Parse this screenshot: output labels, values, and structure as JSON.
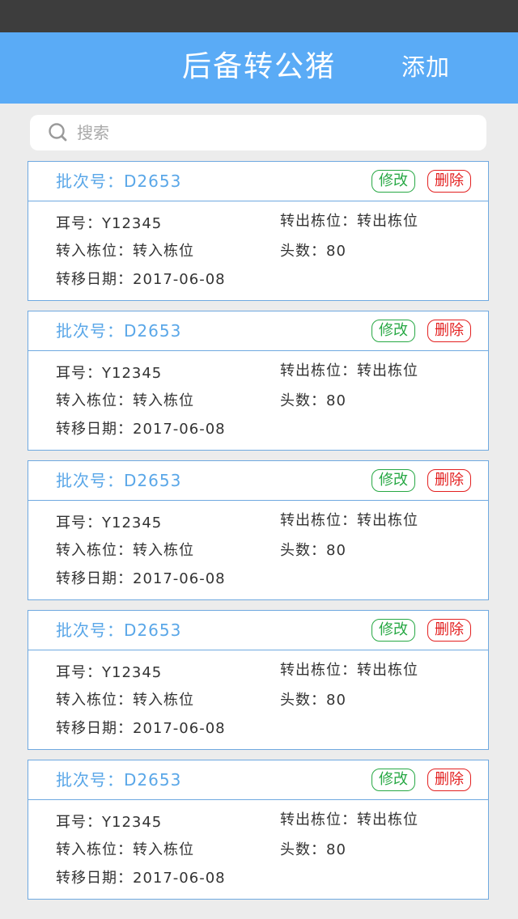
{
  "header": {
    "title": "后备转公猪",
    "add_label": "添加"
  },
  "search": {
    "placeholder": "搜索",
    "value": ""
  },
  "labels": {
    "ear": "耳号",
    "out_pen": "转出栋位",
    "in_pen": "转入栋位",
    "head_count": "头数",
    "date": "转移日期",
    "batch": "批次号",
    "edit": "修改",
    "delete": "删除"
  },
  "records": [
    {
      "batch": "批次号：D2653",
      "ear": "耳号：Y12345",
      "out_pen": "转出栋位：转出栋位",
      "in_pen": "转入栋位：转入栋位",
      "head_count": "头数：80",
      "date": "转移日期：2017-06-08",
      "edit": "修改",
      "delete": "删除"
    },
    {
      "batch": "批次号：D2653",
      "ear": "耳号：Y12345",
      "out_pen": "转出栋位：转出栋位",
      "in_pen": "转入栋位：转入栋位",
      "head_count": "头数：80",
      "date": "转移日期：2017-06-08",
      "edit": "修改",
      "delete": "删除"
    },
    {
      "batch": "批次号：D2653",
      "ear": "耳号：Y12345",
      "out_pen": "转出栋位：转出栋位",
      "in_pen": "转入栋位：转入栋位",
      "head_count": "头数：80",
      "date": "转移日期：2017-06-08",
      "edit": "修改",
      "delete": "删除"
    },
    {
      "batch": "批次号：D2653",
      "ear": "耳号：Y12345",
      "out_pen": "转出栋位：转出栋位",
      "in_pen": "转入栋位：转入栋位",
      "head_count": "头数：80",
      "date": "转移日期：2017-06-08",
      "edit": "修改",
      "delete": "删除"
    },
    {
      "batch": "批次号：D2653",
      "ear": "耳号：Y12345",
      "out_pen": "转出栋位：转出栋位",
      "in_pen": "转入栋位：转入栋位",
      "head_count": "头数：80",
      "date": "转移日期：2017-06-08",
      "edit": "修改",
      "delete": "删除"
    }
  ],
  "colors": {
    "nav": "#5aabf6",
    "status_bar": "#3d3d3d",
    "accent": "#5aa7e8",
    "edit": "#27a844",
    "delete": "#e32020"
  },
  "icons": {
    "search": "search-icon"
  }
}
